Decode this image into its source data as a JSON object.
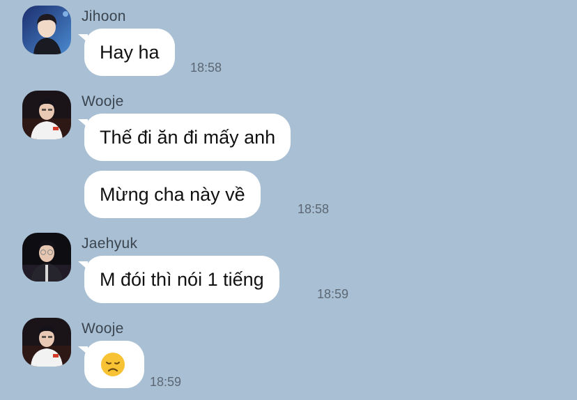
{
  "messages": [
    {
      "sender": "Jihoon",
      "avatar": "avatar-jihoon",
      "bubbles": [
        {
          "text": "Hay ha"
        }
      ],
      "time": "18:58"
    },
    {
      "sender": "Wooje",
      "avatar": "avatar-wooje",
      "bubbles": [
        {
          "text": "Thế đi ăn đi mấy anh"
        },
        {
          "text": "Mừng cha này về"
        }
      ],
      "time": "18:58"
    },
    {
      "sender": "Jaehyuk",
      "avatar": "avatar-jaehyuk",
      "bubbles": [
        {
          "text": "M đói thì nói 1 tiếng"
        }
      ],
      "time": "18:59"
    },
    {
      "sender": "Wooje",
      "avatar": "avatar-wooje",
      "bubbles": [
        {
          "emoji": "disappointed-face"
        }
      ],
      "time": "18:59"
    }
  ],
  "colors": {
    "background": "#a9bfd3",
    "bubble": "#ffffff",
    "sender_name": "#3a4550",
    "timestamp": "#5b6774",
    "emoji": "#f7c233"
  }
}
